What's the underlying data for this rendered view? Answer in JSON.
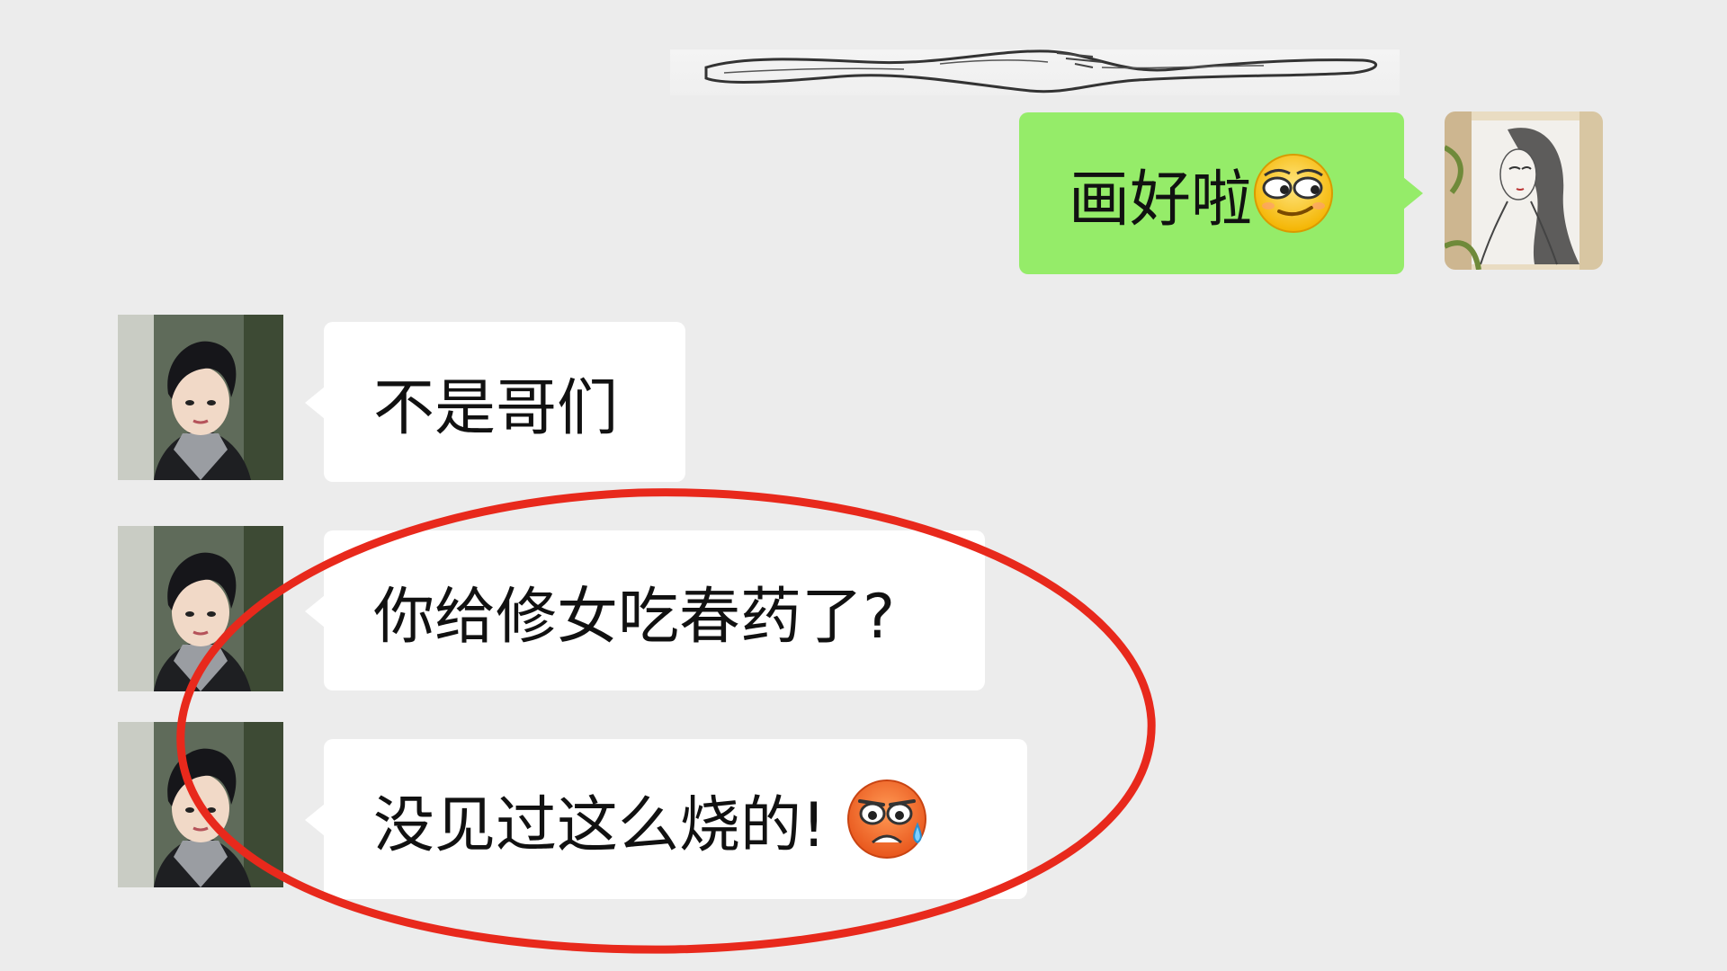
{
  "chat": {
    "messages": [
      {
        "sender": "me",
        "text": "画好啦",
        "emoji": "smirk-emoji"
      },
      {
        "sender": "friend",
        "text": "不是哥们"
      },
      {
        "sender": "friend",
        "text": "你给修女吃春药了?"
      },
      {
        "sender": "friend",
        "text": "没见过这么烧的!",
        "emoji": "anxious-sweat-emoji"
      }
    ]
  },
  "colors": {
    "background": "#ececec",
    "my_bubble": "#95ec69",
    "friend_bubble": "#ffffff",
    "highlight_ring": "#e8291c"
  },
  "icons": {
    "my_avatar": "sketch-portrait-avatar",
    "friend_avatar": "young-man-photo-avatar"
  }
}
